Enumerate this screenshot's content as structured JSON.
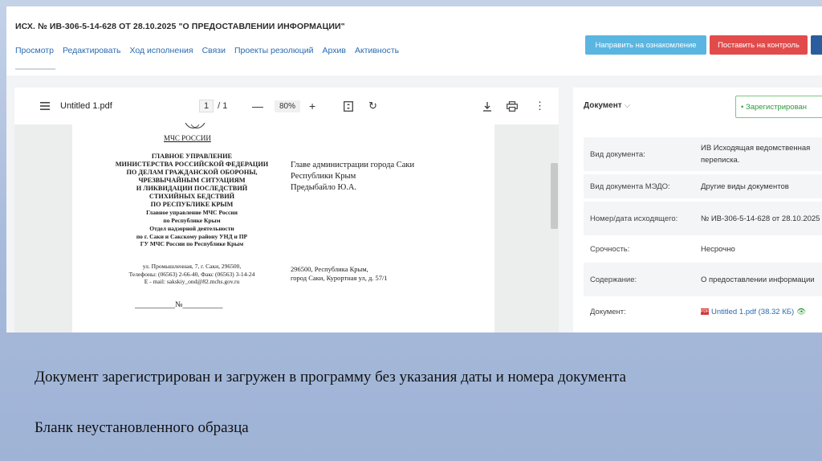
{
  "header": {
    "title": "ИСХ. № ИВ-306-5-14-628 ОТ 28.10.2025 \"О ПРЕДОСТАВЛЕНИИ ИНФОРМАЦИИ\"",
    "tabs": [
      "Просмотр",
      "Редактировать",
      "Ход исполнения",
      "Связи",
      "Проекты резолюций",
      "Архив",
      "Активность"
    ],
    "send_button": "Направить на ознакомление",
    "control_button": "Поставить на контроль"
  },
  "viewer": {
    "file_name": "Untitled 1.pdf",
    "page_current": "1",
    "page_total": "/ 1",
    "zoom": "80%",
    "icons": [
      "menu-icon",
      "zoom-out-icon",
      "zoom-in-icon",
      "fit-page-icon",
      "rotate-icon",
      "download-icon",
      "print-icon",
      "more-icon"
    ]
  },
  "letter": {
    "sender_short": "МЧС РОССИИ",
    "org_lines": [
      "ГЛАВНОЕ УПРАВЛЕНИЕ",
      "МИНИСТЕРСТВА РОССИЙСКОЙ ФЕДЕРАЦИИ",
      "ПО ДЕЛАМ ГРАЖДАНСКОЙ ОБОРОНЫ,",
      "ЧРЕЗВЫЧАЙНЫМ СИТУАЦИЯМ",
      "И ЛИКВИДАЦИИ ПОСЛЕДСТВИЙ",
      "СТИХИЙНЫХ БЕДСТВИЙ",
      "ПО РЕСПУБЛИКЕ КРЫМ"
    ],
    "org_sub_lines": [
      "Главное управление МЧС России",
      "по Республике Крым"
    ],
    "dept_lines": [
      "Отдел надзорной деятельности",
      "по г. Саки и Сакскому району УНД и ПР",
      "ГУ МЧС России по Республике Крым"
    ],
    "contact_lines": [
      "ул. Промышленная, 7, г. Саки, 296500,",
      "Телефоны: (06563) 2-66-40, Факс (06563) 3-14-24",
      "E - mail: sakskiy_ond@82.mchs.gov.ru"
    ],
    "recipient_lines": [
      "Главе администрации города Саки",
      "Республики Крым",
      "Предыбайло Ю.А."
    ],
    "address_lines": [
      "296500, Республика Крым,",
      "город Саки, Курортная ул, д. 57/1"
    ],
    "number_line": "__________№__________"
  },
  "panel": {
    "heading": "Документ",
    "status": "• Зарегистрирован",
    "rows": [
      {
        "label": "Вид документа:",
        "value": "ИВ Исходящая ведомственная переписка."
      },
      {
        "label": "Вид документа МЭДО:",
        "value": "Другие виды документов"
      },
      {
        "label": "Номер/дата исходящего:",
        "value": "№ ИВ-306-5-14-628 от 28.10.2025"
      },
      {
        "label": "Срочность:",
        "value": "Несрочно"
      },
      {
        "label": "Содержание:",
        "value": "О предоставлении информации"
      },
      {
        "label": "Документ:",
        "value": "Untitled 1.pdf (38.32 КБ)"
      }
    ]
  },
  "captions": {
    "line1": "Документ зарегистрирован и загружен в программу без указания даты и номера документа",
    "line2": "Бланк неустановленного образца"
  }
}
